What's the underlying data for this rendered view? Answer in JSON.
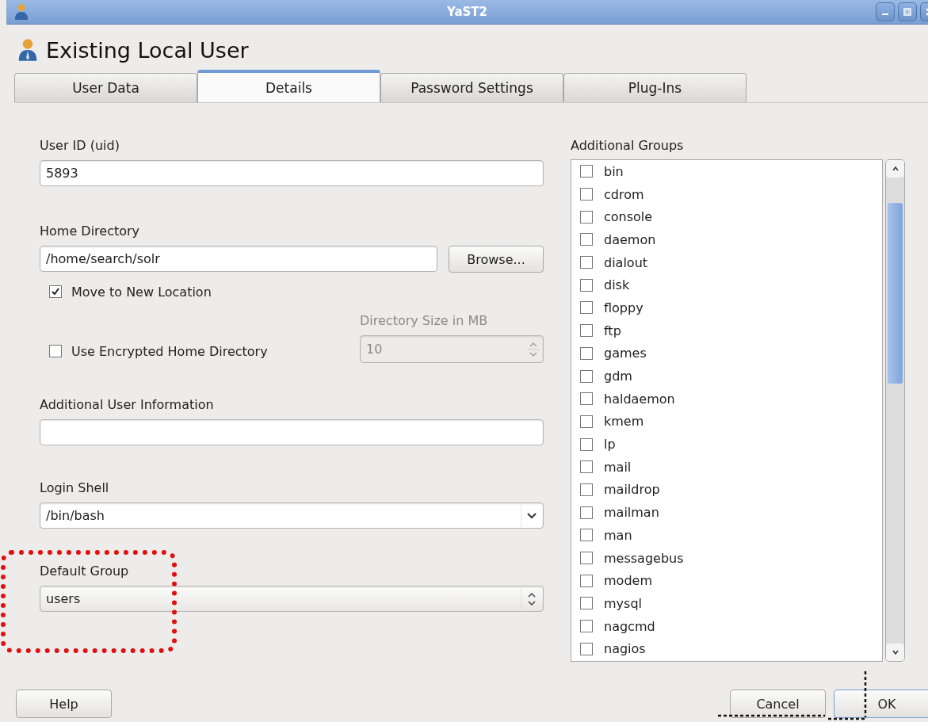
{
  "window": {
    "title": "YaST2"
  },
  "header": {
    "title": "Existing Local User"
  },
  "tabs": [
    {
      "label": "User Data",
      "selected": false
    },
    {
      "label": "Details",
      "selected": true
    },
    {
      "label": "Password Settings",
      "selected": false
    },
    {
      "label": "Plug-Ins",
      "selected": false
    }
  ],
  "details": {
    "uid": {
      "label": "User ID (uid)",
      "value": "5893"
    },
    "home": {
      "label": "Home Directory",
      "value": "/home/search/solr",
      "browse": "Browse..."
    },
    "move": {
      "label": "Move to New Location",
      "checked": true
    },
    "encrypted": {
      "label": "Use Encrypted Home Directory",
      "checked": false
    },
    "dir_size": {
      "label": "Directory Size in MB",
      "value": "10",
      "disabled": true
    },
    "additional_info": {
      "label": "Additional User Information"
    },
    "login_shell": {
      "label": "Login Shell",
      "value": "/bin/bash"
    },
    "default_group": {
      "label": "Default Group",
      "value": "users"
    }
  },
  "groups": {
    "label": "Additional Groups",
    "items": [
      {
        "name": "bin",
        "checked": false
      },
      {
        "name": "cdrom",
        "checked": false
      },
      {
        "name": "console",
        "checked": false
      },
      {
        "name": "daemon",
        "checked": false
      },
      {
        "name": "dialout",
        "checked": false
      },
      {
        "name": "disk",
        "checked": false
      },
      {
        "name": "floppy",
        "checked": false
      },
      {
        "name": "ftp",
        "checked": false
      },
      {
        "name": "games",
        "checked": false
      },
      {
        "name": "gdm",
        "checked": false
      },
      {
        "name": "haldaemon",
        "checked": false
      },
      {
        "name": "kmem",
        "checked": false
      },
      {
        "name": "lp",
        "checked": false
      },
      {
        "name": "mail",
        "checked": false
      },
      {
        "name": "maildrop",
        "checked": false
      },
      {
        "name": "mailman",
        "checked": false
      },
      {
        "name": "man",
        "checked": false
      },
      {
        "name": "messagebus",
        "checked": false
      },
      {
        "name": "modem",
        "checked": false
      },
      {
        "name": "mysql",
        "checked": false
      },
      {
        "name": "nagcmd",
        "checked": false
      },
      {
        "name": "nagios",
        "checked": false
      }
    ]
  },
  "buttons": {
    "help": "Help",
    "cancel": "Cancel",
    "ok": "OK"
  }
}
